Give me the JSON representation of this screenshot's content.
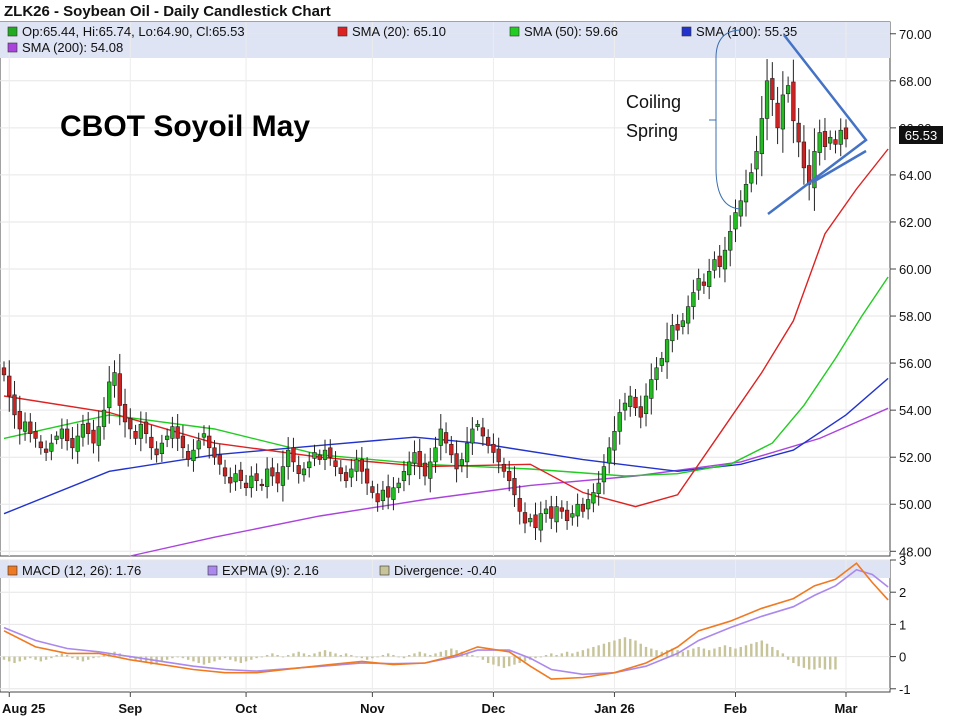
{
  "chart_title": "ZLK26 - Soybean Oil - Daily Candlestick Chart",
  "legend_main": [
    {
      "key": "ohlc",
      "label": "Op:65.44, Hi:65.74, Lo:64.90, Cl:65.53",
      "color": "#22aa22"
    },
    {
      "key": "sma20",
      "label": "SMA (20): 65.10",
      "color": "#dd2222"
    },
    {
      "key": "sma50",
      "label": "SMA (50): 59.66",
      "color": "#22cc22"
    },
    {
      "key": "sma100",
      "label": "SMA (100): 55.35",
      "color": "#2233cc"
    },
    {
      "key": "sma200",
      "label": "SMA (200): 54.08",
      "color": "#aa44dd"
    }
  ],
  "legend_lower": [
    {
      "key": "macd",
      "label": "MACD (12, 26): 1.76",
      "color": "#f07a22"
    },
    {
      "key": "expma",
      "label": "EXPMA (9): 2.16",
      "color": "#aa88ee"
    },
    {
      "key": "div",
      "label": "Divergence: -0.40",
      "color": "#c8c49a"
    }
  ],
  "overlay_title": "CBOT Soyoil May",
  "annotation": {
    "line1": "Coiling",
    "line2": "Spring"
  },
  "last_price_label": "65.53",
  "chart_data": [
    {
      "type": "candlestick",
      "title": "ZLK26 - Soybean Oil - Daily Candlestick Chart",
      "x_tick_labels": [
        "Aug 25",
        "Sep",
        "Oct",
        "Nov",
        "Dec",
        "Jan 26",
        "Feb",
        "Mar"
      ],
      "y_ticks": [
        48,
        50,
        52,
        54,
        56,
        58,
        60,
        62,
        64,
        66,
        68,
        70
      ],
      "y_tick_labels": [
        "48.00",
        "50.00",
        "52.00",
        "54.00",
        "56.00",
        "58.00",
        "60.00",
        "62.00",
        "64.00",
        "66.00",
        "68.00",
        "70.00"
      ],
      "ylim": [
        47.8,
        70.5
      ],
      "grid": true,
      "axis_side": "right",
      "closes": [
        55.5,
        54.6,
        53.8,
        53.2,
        53.5,
        53.0,
        52.8,
        52.4,
        52.2,
        52.6,
        52.9,
        53.2,
        52.7,
        52.4,
        52.9,
        53.4,
        53.0,
        52.6,
        53.3,
        54.0,
        55.2,
        55.6,
        54.2,
        53.5,
        53.2,
        52.8,
        53.4,
        53.0,
        52.4,
        52.1,
        52.6,
        52.9,
        53.3,
        52.8,
        52.4,
        51.9,
        52.3,
        52.7,
        53.0,
        52.4,
        52.0,
        51.7,
        51.2,
        50.9,
        51.3,
        51.0,
        50.7,
        51.2,
        51.0,
        50.8,
        51.5,
        51.2,
        50.9,
        51.6,
        52.3,
        51.8,
        51.3,
        51.5,
        51.8,
        52.2,
        51.9,
        52.3,
        52.0,
        51.6,
        51.3,
        51.0,
        51.5,
        51.9,
        51.4,
        50.9,
        50.5,
        50.1,
        50.6,
        50.3,
        50.7,
        50.9,
        51.4,
        51.8,
        52.2,
        51.6,
        51.2,
        51.8,
        52.4,
        53.2,
        52.6,
        52.1,
        51.5,
        51.9,
        52.6,
        53.2,
        53.4,
        52.9,
        52.5,
        52.2,
        51.8,
        51.4,
        51.0,
        50.4,
        49.7,
        49.2,
        49.4,
        49.0,
        49.6,
        49.8,
        49.4,
        49.9,
        49.7,
        49.3,
        49.6,
        50.0,
        49.7,
        50.2,
        50.5,
        50.9,
        51.6,
        52.4,
        53.1,
        53.9,
        54.3,
        54.6,
        54.1,
        53.7,
        54.6,
        55.3,
        55.8,
        56.2,
        57.0,
        57.6,
        57.4,
        57.8,
        58.4,
        59.0,
        59.6,
        59.3,
        59.9,
        60.4,
        60.1,
        60.8,
        61.6,
        62.4,
        62.9,
        63.6,
        64.1,
        65.0,
        66.4,
        68.0,
        67.2,
        66.0,
        67.4,
        67.8,
        66.3,
        65.4,
        64.3,
        63.6,
        65.0,
        65.8,
        65.2,
        65.6,
        65.3,
        65.9,
        65.53
      ],
      "sma20": [
        {
          "x": 0,
          "y": 54.6
        },
        {
          "x": 20,
          "y": 53.9
        },
        {
          "x": 40,
          "y": 52.6
        },
        {
          "x": 60,
          "y": 52.0
        },
        {
          "x": 80,
          "y": 51.6
        },
        {
          "x": 100,
          "y": 51.7
        },
        {
          "x": 110,
          "y": 50.5
        },
        {
          "x": 120,
          "y": 49.9
        },
        {
          "x": 128,
          "y": 50.4
        },
        {
          "x": 136,
          "y": 53.0
        },
        {
          "x": 144,
          "y": 55.6
        },
        {
          "x": 150,
          "y": 57.8
        },
        {
          "x": 156,
          "y": 61.5
        },
        {
          "x": 162,
          "y": 63.4
        },
        {
          "x": 168,
          "y": 65.1
        }
      ],
      "sma50": [
        {
          "x": 0,
          "y": 52.8
        },
        {
          "x": 20,
          "y": 53.8
        },
        {
          "x": 40,
          "y": 53.2
        },
        {
          "x": 60,
          "y": 52.1
        },
        {
          "x": 80,
          "y": 51.7
        },
        {
          "x": 100,
          "y": 51.5
        },
        {
          "x": 118,
          "y": 51.2
        },
        {
          "x": 128,
          "y": 51.3
        },
        {
          "x": 138,
          "y": 51.7
        },
        {
          "x": 146,
          "y": 52.6
        },
        {
          "x": 152,
          "y": 54.2
        },
        {
          "x": 158,
          "y": 56.2
        },
        {
          "x": 163,
          "y": 58.0
        },
        {
          "x": 168,
          "y": 59.66
        }
      ],
      "sma100": [
        {
          "x": 0,
          "y": 49.6
        },
        {
          "x": 20,
          "y": 51.4
        },
        {
          "x": 40,
          "y": 52.1
        },
        {
          "x": 60,
          "y": 52.5
        },
        {
          "x": 78,
          "y": 52.85
        },
        {
          "x": 90,
          "y": 52.6
        },
        {
          "x": 110,
          "y": 51.9
        },
        {
          "x": 128,
          "y": 51.4
        },
        {
          "x": 140,
          "y": 51.7
        },
        {
          "x": 150,
          "y": 52.3
        },
        {
          "x": 160,
          "y": 53.8
        },
        {
          "x": 168,
          "y": 55.35
        }
      ],
      "sma200": [
        {
          "x": 24,
          "y": 47.8
        },
        {
          "x": 40,
          "y": 48.6
        },
        {
          "x": 60,
          "y": 49.5
        },
        {
          "x": 80,
          "y": 50.2
        },
        {
          "x": 100,
          "y": 50.8
        },
        {
          "x": 120,
          "y": 51.2
        },
        {
          "x": 140,
          "y": 51.8
        },
        {
          "x": 155,
          "y": 52.8
        },
        {
          "x": 168,
          "y": 54.08
        }
      ]
    },
    {
      "type": "line",
      "title": "MACD",
      "y_ticks": [
        -1,
        0,
        1,
        2,
        3
      ],
      "y_tick_labels": [
        "-1",
        "0",
        "1",
        "2",
        "3"
      ],
      "ylim": [
        -1.1,
        3.0
      ],
      "grid": true,
      "series": [
        {
          "name": "MACD (12, 26)",
          "color": "#f07a22",
          "points": [
            {
              "x": 0,
              "y": 0.8
            },
            {
              "x": 6,
              "y": 0.3
            },
            {
              "x": 12,
              "y": 0.1
            },
            {
              "x": 18,
              "y": 0.1
            },
            {
              "x": 24,
              "y": -0.1
            },
            {
              "x": 30,
              "y": -0.25
            },
            {
              "x": 36,
              "y": -0.4
            },
            {
              "x": 42,
              "y": -0.5
            },
            {
              "x": 48,
              "y": -0.5
            },
            {
              "x": 56,
              "y": -0.35
            },
            {
              "x": 62,
              "y": -0.25
            },
            {
              "x": 68,
              "y": -0.15
            },
            {
              "x": 74,
              "y": -0.25
            },
            {
              "x": 80,
              "y": -0.2
            },
            {
              "x": 86,
              "y": 0.05
            },
            {
              "x": 90,
              "y": 0.3
            },
            {
              "x": 96,
              "y": 0.15
            },
            {
              "x": 100,
              "y": -0.3
            },
            {
              "x": 104,
              "y": -0.7
            },
            {
              "x": 110,
              "y": -0.65
            },
            {
              "x": 116,
              "y": -0.5
            },
            {
              "x": 122,
              "y": -0.2
            },
            {
              "x": 128,
              "y": 0.3
            },
            {
              "x": 132,
              "y": 0.8
            },
            {
              "x": 138,
              "y": 1.1
            },
            {
              "x": 144,
              "y": 1.5
            },
            {
              "x": 150,
              "y": 1.8
            },
            {
              "x": 154,
              "y": 2.2
            },
            {
              "x": 158,
              "y": 2.4
            },
            {
              "x": 162,
              "y": 2.9
            },
            {
              "x": 165,
              "y": 2.3
            },
            {
              "x": 168,
              "y": 1.76
            }
          ]
        },
        {
          "name": "EXPMA (9)",
          "color": "#aa88ee",
          "points": [
            {
              "x": 0,
              "y": 0.9
            },
            {
              "x": 6,
              "y": 0.5
            },
            {
              "x": 12,
              "y": 0.25
            },
            {
              "x": 18,
              "y": 0.15
            },
            {
              "x": 24,
              "y": 0.0
            },
            {
              "x": 30,
              "y": -0.15
            },
            {
              "x": 36,
              "y": -0.3
            },
            {
              "x": 42,
              "y": -0.4
            },
            {
              "x": 48,
              "y": -0.45
            },
            {
              "x": 56,
              "y": -0.35
            },
            {
              "x": 62,
              "y": -0.28
            },
            {
              "x": 68,
              "y": -0.2
            },
            {
              "x": 74,
              "y": -0.22
            },
            {
              "x": 80,
              "y": -0.2
            },
            {
              "x": 86,
              "y": 0.0
            },
            {
              "x": 90,
              "y": 0.2
            },
            {
              "x": 96,
              "y": 0.2
            },
            {
              "x": 100,
              "y": -0.05
            },
            {
              "x": 104,
              "y": -0.4
            },
            {
              "x": 110,
              "y": -0.55
            },
            {
              "x": 116,
              "y": -0.5
            },
            {
              "x": 122,
              "y": -0.3
            },
            {
              "x": 128,
              "y": 0.1
            },
            {
              "x": 132,
              "y": 0.5
            },
            {
              "x": 138,
              "y": 0.9
            },
            {
              "x": 144,
              "y": 1.25
            },
            {
              "x": 150,
              "y": 1.55
            },
            {
              "x": 154,
              "y": 1.9
            },
            {
              "x": 158,
              "y": 2.2
            },
            {
              "x": 162,
              "y": 2.7
            },
            {
              "x": 165,
              "y": 2.55
            },
            {
              "x": 168,
              "y": 2.16
            }
          ]
        }
      ],
      "divergence": [
        -0.1,
        -0.15,
        -0.2,
        -0.15,
        -0.1,
        -0.05,
        -0.1,
        -0.15,
        -0.1,
        -0.05,
        0.05,
        0.1,
        0.05,
        -0.05,
        -0.1,
        -0.15,
        -0.1,
        -0.05,
        0.0,
        0.05,
        0.1,
        0.15,
        0.1,
        0.05,
        -0.05,
        -0.1,
        -0.15,
        -0.2,
        -0.25,
        -0.2,
        -0.15,
        -0.1,
        -0.05,
        0.0,
        -0.05,
        -0.1,
        -0.15,
        -0.2,
        -0.25,
        -0.2,
        -0.15,
        -0.1,
        -0.05,
        -0.1,
        -0.15,
        -0.2,
        -0.15,
        -0.1,
        -0.05,
        0.0,
        0.05,
        0.1,
        0.05,
        0.0,
        0.05,
        0.1,
        0.15,
        0.1,
        0.05,
        0.1,
        0.15,
        0.2,
        0.15,
        0.1,
        0.05,
        0.1,
        0.05,
        0.0,
        -0.05,
        -0.1,
        -0.05,
        0.0,
        0.05,
        0.1,
        0.05,
        0.0,
        -0.05,
        0.05,
        0.1,
        0.15,
        0.1,
        0.05,
        0.1,
        0.15,
        0.2,
        0.25,
        0.2,
        0.15,
        0.1,
        0.05,
        0.0,
        -0.1,
        -0.2,
        -0.25,
        -0.3,
        -0.35,
        -0.3,
        -0.25,
        -0.2,
        -0.15,
        -0.1,
        -0.05,
        0.0,
        0.05,
        0.1,
        0.05,
        0.1,
        0.15,
        0.1,
        0.15,
        0.2,
        0.25,
        0.3,
        0.35,
        0.4,
        0.45,
        0.5,
        0.55,
        0.6,
        0.55,
        0.5,
        0.4,
        0.3,
        0.25,
        0.2,
        0.15,
        0.2,
        0.25,
        0.2,
        0.15,
        0.2,
        0.25,
        0.3,
        0.25,
        0.2,
        0.25,
        0.3,
        0.35,
        0.3,
        0.25,
        0.3,
        0.35,
        0.4,
        0.45,
        0.5,
        0.4,
        0.3,
        0.2,
        0.1,
        -0.1,
        -0.2,
        -0.3,
        -0.35,
        -0.4,
        -0.4,
        -0.35,
        -0.4,
        -0.4,
        -0.4
      ]
    }
  ]
}
